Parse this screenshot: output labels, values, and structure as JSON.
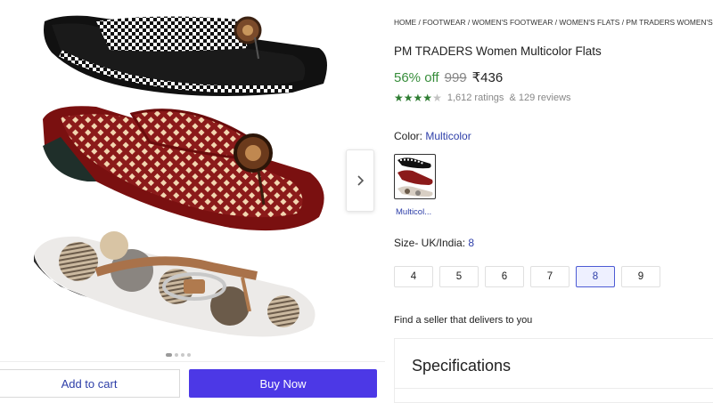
{
  "breadcrumb": [
    "HOME",
    "FOOTWEAR",
    "WOMEN'S FOOTWEAR",
    "WOMEN'S FLATS",
    "PM TRADERS WOMEN'S FLATS"
  ],
  "product": {
    "title": "PM TRADERS Women Multicolor Flats",
    "discount": "56% off",
    "mrp": "999",
    "price": "₹436",
    "rating_value": 4,
    "ratings_text": "1,612 ratings",
    "reviews_text": "& 129 reviews"
  },
  "color": {
    "label": "Color:",
    "value": "Multicolor",
    "swatch_caption": "Multicol..."
  },
  "size": {
    "label": "Size- UK/India:",
    "value": "8",
    "options": [
      "4",
      "5",
      "6",
      "7",
      "8",
      "9"
    ],
    "selected": "8"
  },
  "seller_text": "Find a seller that delivers to you",
  "specs_title": "Specifications",
  "actions": {
    "add_to_cart": "Add to cart",
    "buy_now": "Buy Now"
  },
  "gallery": {
    "slides": 4,
    "active_slide": 1
  },
  "colors": {
    "accent": "#4c38e6",
    "link": "#2d3ea8",
    "discount_green": "#388e3c",
    "star_green": "#2e7d32"
  },
  "icons": [
    "chevron-right-icon",
    "star-icon"
  ]
}
